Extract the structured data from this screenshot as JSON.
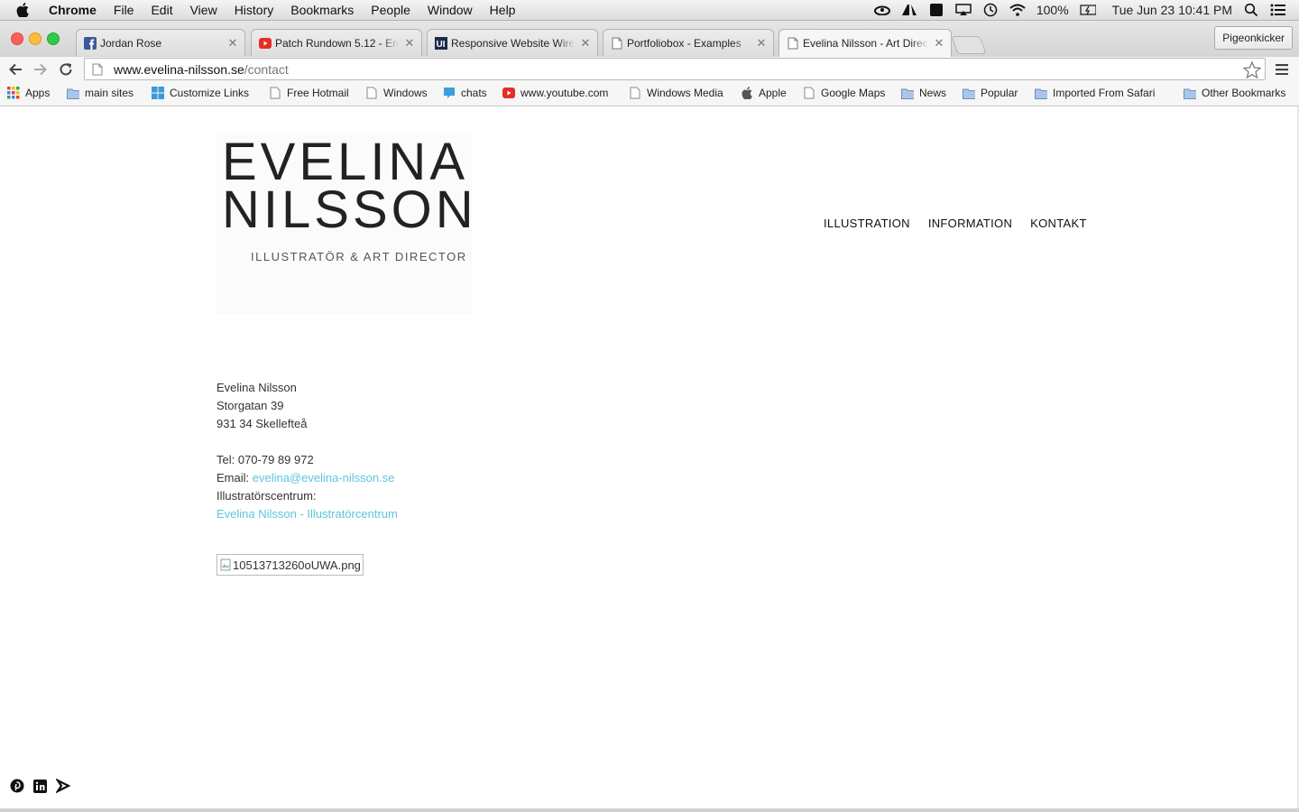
{
  "menubar": {
    "app": "Chrome",
    "items": [
      "File",
      "Edit",
      "View",
      "History",
      "Bookmarks",
      "People",
      "Window",
      "Help"
    ],
    "battery": "100%",
    "clock": "Tue Jun 23  10:41 PM"
  },
  "tabs": [
    {
      "title": "Jordan Rose",
      "favicon": "facebook-icon"
    },
    {
      "title": "Patch Rundown 5.12 - Ent",
      "favicon": "youtube-icon"
    },
    {
      "title": "Responsive Website Wiref",
      "favicon": "ui-icon"
    },
    {
      "title": "Portfoliobox - Examples",
      "favicon": "page-icon"
    },
    {
      "title": "Evelina Nilsson - Art Direct",
      "favicon": "page-icon",
      "active": true
    }
  ],
  "profile_button": "Pigeonkicker",
  "address": {
    "host": "www.evelina-nilsson.se",
    "path": "/contact"
  },
  "bookmarks": [
    {
      "label": "Apps",
      "icon": "apps-grid-icon"
    },
    {
      "label": "main sites",
      "icon": "folder-icon"
    },
    {
      "label": "Customize Links",
      "icon": "windows-icon"
    },
    {
      "label": "Free Hotmail",
      "icon": "page-icon"
    },
    {
      "label": "Windows",
      "icon": "page-icon"
    },
    {
      "label": "chats",
      "icon": "chat-icon"
    },
    {
      "label": "www.youtube.com",
      "icon": "youtube-icon"
    },
    {
      "label": "Windows Media",
      "icon": "page-icon"
    },
    {
      "label": "Apple",
      "icon": "apple-icon"
    },
    {
      "label": "Google Maps",
      "icon": "page-icon"
    },
    {
      "label": "News",
      "icon": "folder-icon"
    },
    {
      "label": "Popular",
      "icon": "folder-icon"
    },
    {
      "label": "Imported From Safari",
      "icon": "folder-icon"
    },
    {
      "label": "Other Bookmarks",
      "icon": "folder-icon"
    }
  ],
  "site": {
    "logo_line1": "EVELINA",
    "logo_line2": "NILSSON",
    "logo_sub": "ILLUSTRATÖR & ART DIRECTOR",
    "nav": [
      "ILLUSTRATION",
      "INFORMATION",
      "KONTAKT"
    ],
    "contact": {
      "name": "Evelina Nilsson",
      "street": "Storgatan 39",
      "city": "931 34 Skellefteå",
      "tel": "Tel: 070-79 89 972",
      "email_label": "Email: ",
      "email": "evelina@evelina-nilsson.se",
      "centrum_label": "Illustratörscentrum:",
      "centrum_link": "Evelina Nilsson - Illustratörcentrum"
    },
    "broken_image_alt": "10513713260oUWA.png"
  },
  "colors": {
    "link": "#5bc6d8",
    "close_red": "#fc605b",
    "min_yellow": "#fdbc40",
    "max_green": "#34c84a"
  }
}
